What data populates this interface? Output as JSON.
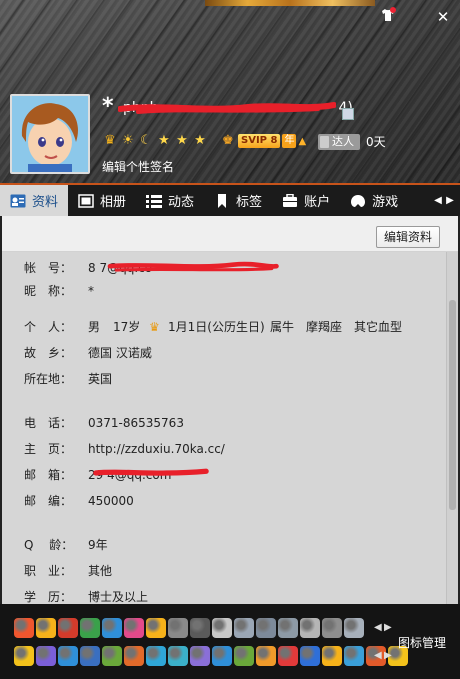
{
  "window": {
    "skin_icon": "tshirt-icon",
    "close_icon": "close-icon"
  },
  "profile": {
    "nickname_prefix": "*",
    "nickname_visible": "phnh",
    "nickname_suffix": "4)",
    "signature": "编辑个性签名",
    "vip_label": "SVIP 8",
    "vip_year": "年",
    "daren_label": "达人",
    "daren_days": "0天"
  },
  "tabs": [
    {
      "label": "资料",
      "icon": "profile-card-icon",
      "active": true
    },
    {
      "label": "相册",
      "icon": "photo-album-icon",
      "active": false
    },
    {
      "label": "动态",
      "icon": "feed-list-icon",
      "active": false
    },
    {
      "label": "标签",
      "icon": "bookmark-tag-icon",
      "active": false
    },
    {
      "label": "账户",
      "icon": "wallet-icon",
      "active": false
    },
    {
      "label": "游戏",
      "icon": "game-icon",
      "active": false
    }
  ],
  "main": {
    "edit_button": "编辑资料"
  },
  "info": {
    "account_label": "帐　号：",
    "account_value": "8        7@qq.co",
    "nickname_label": "昵　称：",
    "nickname_value": "*",
    "personal_label": "个　人：",
    "gender": "男",
    "age": "17岁",
    "birthday": "1月1日(公历生日)",
    "zodiac": "属牛",
    "constellation": "摩羯座",
    "blood": "其它血型",
    "hometown_label": "故　乡：",
    "hometown_value": "德国 汉诺威",
    "location_label": "所在地：",
    "location_value": "英国",
    "phone_label": "电　话：",
    "phone_value": "0371-86535763",
    "homepage_label": "主　页：",
    "homepage_value": "http://zzduxiu.70ka.cc/",
    "email_label": "邮　箱：",
    "email_value": "29        4@qq.com",
    "zip_label": "邮　编：",
    "zip_value": "450000",
    "qage_label": "Q　 龄：",
    "qage_value": "9年",
    "job_label": "职　业：",
    "job_value": "其他",
    "edu_label": "学　历：",
    "edu_value": "博士及以上"
  },
  "iconbar": {
    "manage_label": "图标管理"
  }
}
